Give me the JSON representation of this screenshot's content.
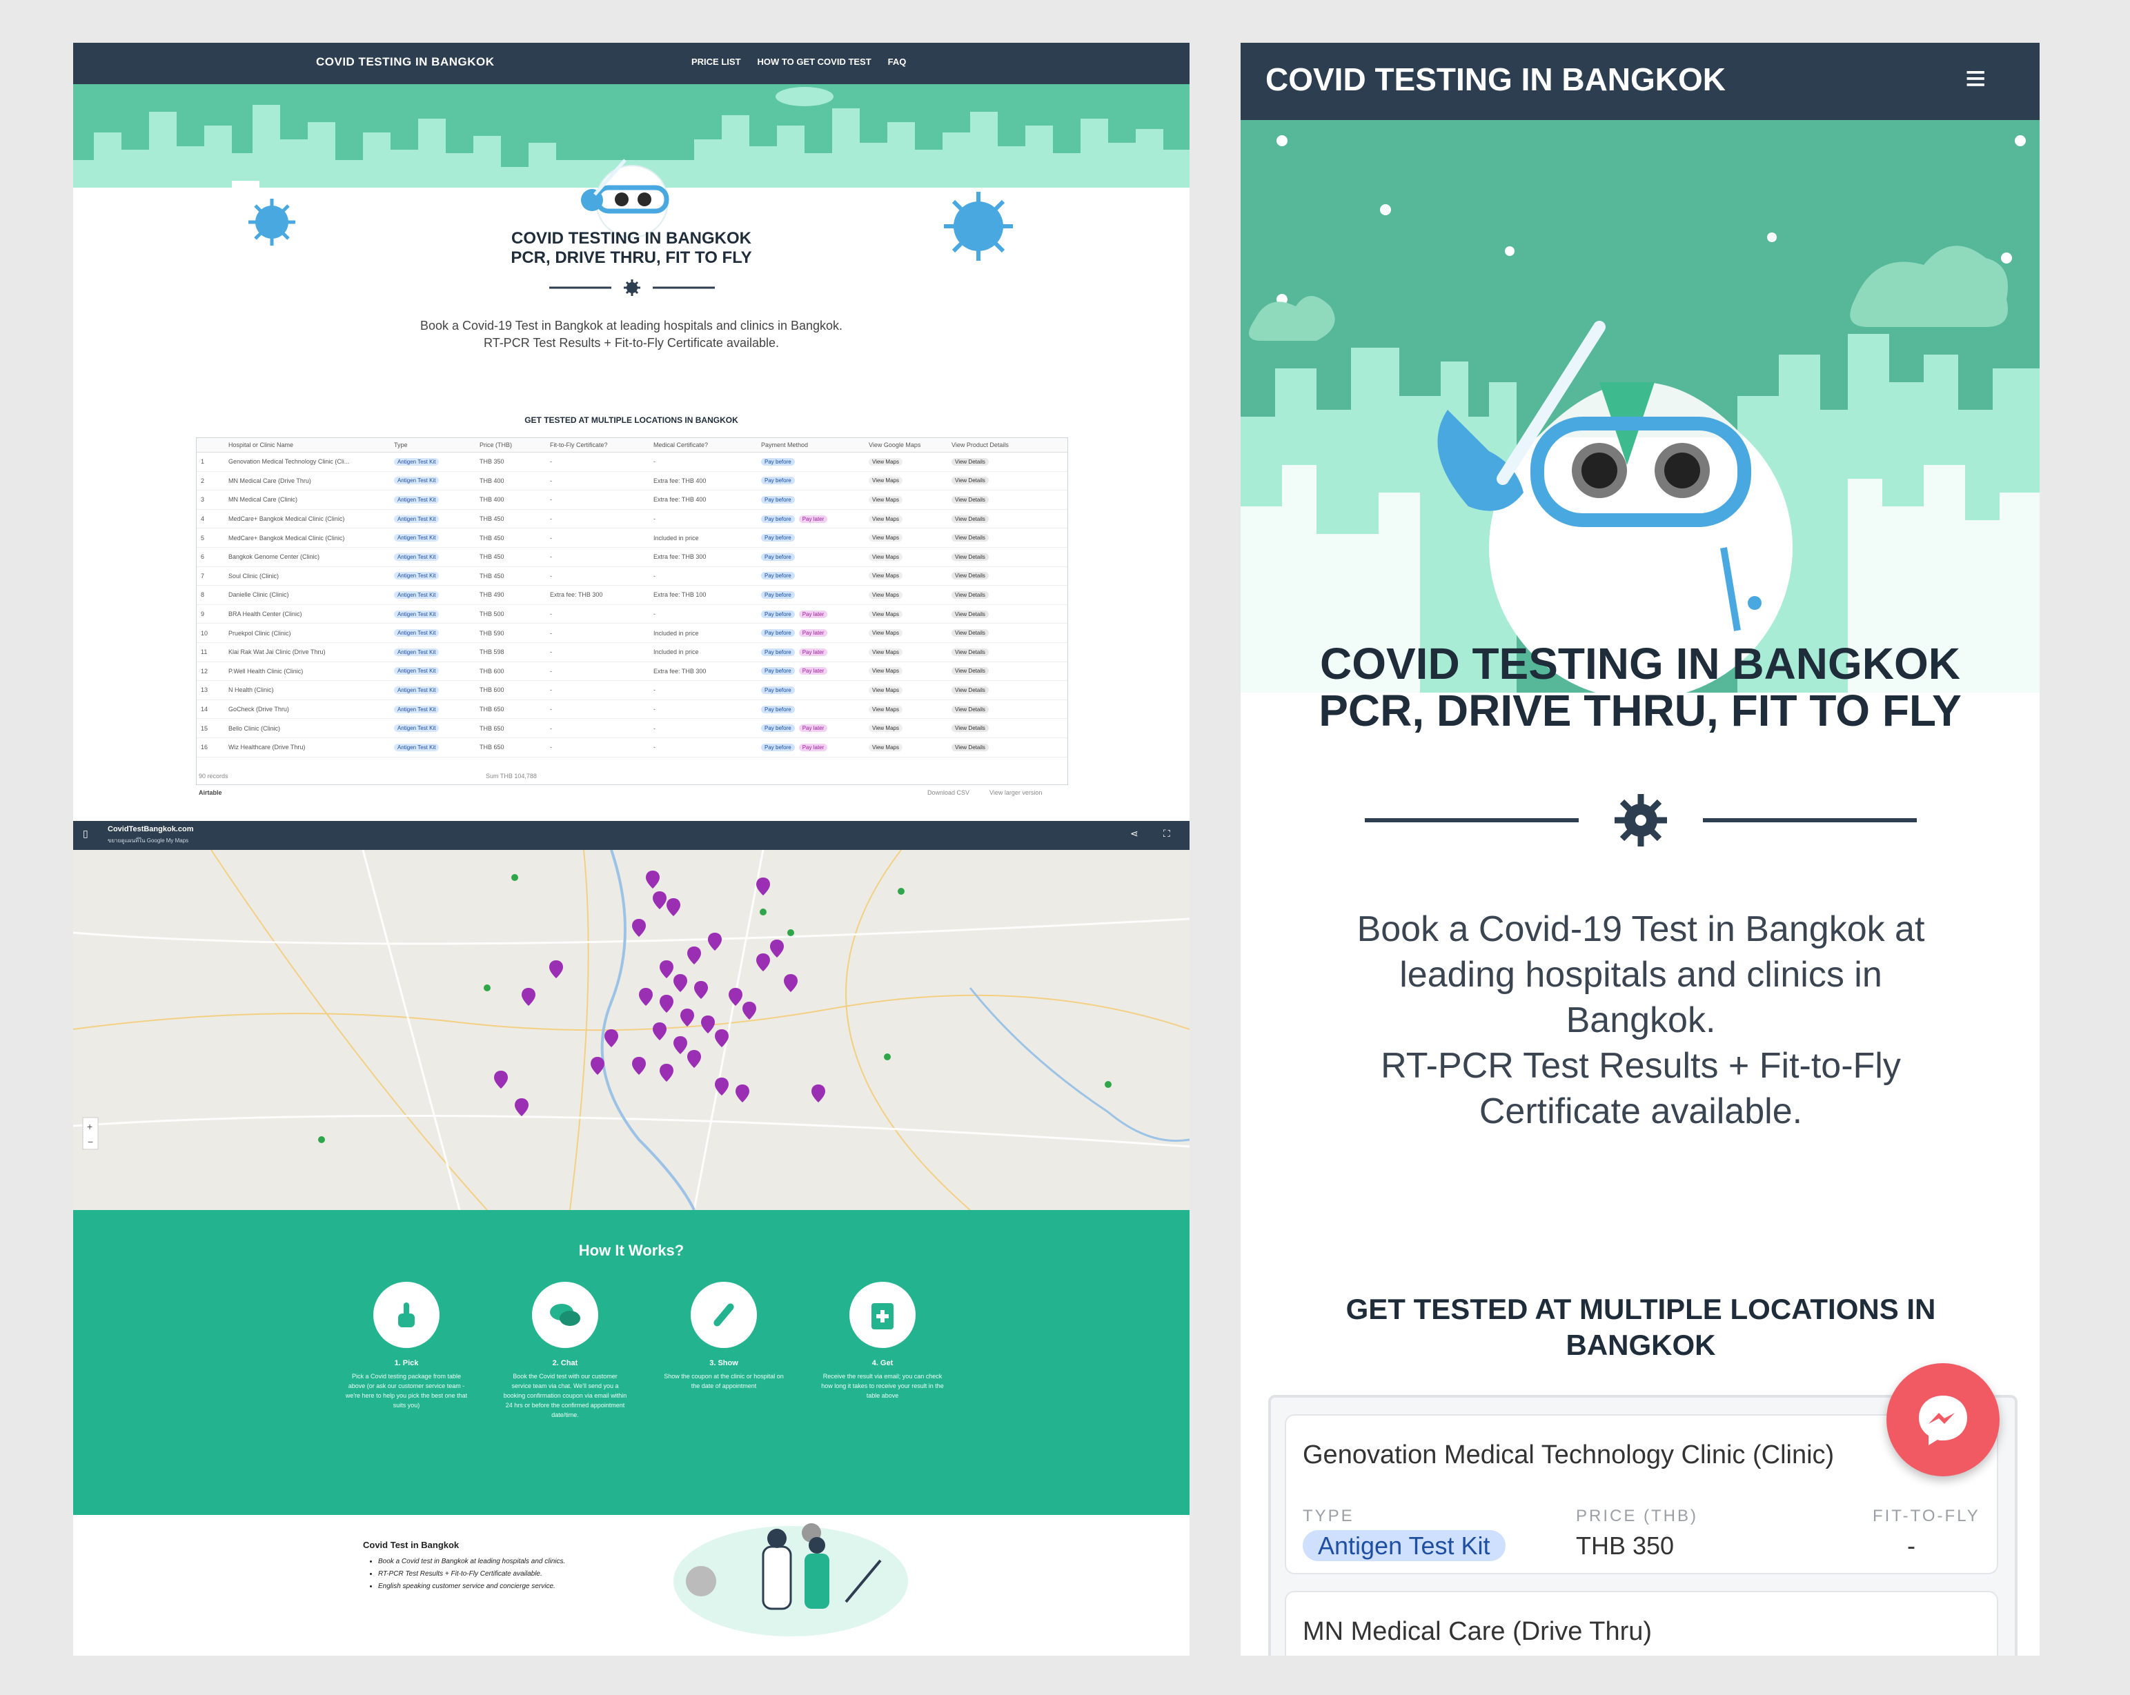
{
  "desktop": {
    "brand": "COVID TESTING IN BANGKOK",
    "nav": [
      "PRICE LIST",
      "HOW TO GET COVID TEST",
      "FAQ"
    ],
    "title_line1": "COVID TESTING IN BANGKOK",
    "title_line2": "PCR, DRIVE THRU, FIT TO FLY",
    "subtitle_line1": "Book a Covid-19 Test in Bangkok at leading hospitals and clinics in Bangkok.",
    "subtitle_line2": "RT-PCR Test Results + Fit-to-Fly Certificate available.",
    "locations_heading": "GET TESTED AT MULTIPLE LOCATIONS IN BANGKOK",
    "table": {
      "headers": [
        "",
        "Hospital or Clinic Name",
        "Type",
        "Price (THB)",
        "Fit-to-Fly Certificate?",
        "Medical Certificate?",
        "Payment Method",
        "View Google Maps",
        "View Product Details"
      ],
      "rows": [
        {
          "n": "1",
          "name": "Genovation Medical Technology Clinic (Cli...",
          "type": "Antigen Test Kit",
          "price": "THB 350",
          "ftf": "-",
          "med": "-",
          "pay": "Pay before",
          "later": ""
        },
        {
          "n": "2",
          "name": "MN Medical Care (Drive Thru)",
          "type": "Antigen Test Kit",
          "price": "THB 400",
          "ftf": "-",
          "med": "Extra fee: THB 400",
          "pay": "Pay before",
          "later": ""
        },
        {
          "n": "3",
          "name": "MN Medical Care (Clinic)",
          "type": "Antigen Test Kit",
          "price": "THB 400",
          "ftf": "-",
          "med": "Extra fee: THB 400",
          "pay": "Pay before",
          "later": ""
        },
        {
          "n": "4",
          "name": "MedCare+ Bangkok Medical Clinic (Clinic)",
          "type": "Antigen Test Kit",
          "price": "THB 450",
          "ftf": "-",
          "med": "-",
          "pay": "Pay before",
          "later": "Pay later"
        },
        {
          "n": "5",
          "name": "MedCare+ Bangkok Medical Clinic (Clinic)",
          "type": "Antigen Test Kit",
          "price": "THB 450",
          "ftf": "-",
          "med": "Included in price",
          "pay": "Pay before",
          "later": ""
        },
        {
          "n": "6",
          "name": "Bangkok Genome Center (Clinic)",
          "type": "Antigen Test Kit",
          "price": "THB 450",
          "ftf": "-",
          "med": "Extra fee: THB 300",
          "pay": "Pay before",
          "later": ""
        },
        {
          "n": "7",
          "name": "Soul Clinic (Clinic)",
          "type": "Antigen Test Kit",
          "price": "THB 450",
          "ftf": "-",
          "med": "-",
          "pay": "Pay before",
          "later": ""
        },
        {
          "n": "8",
          "name": "Danielle Clinic (Clinic)",
          "type": "Antigen Test Kit",
          "price": "THB 490",
          "ftf": "Extra fee: THB 300",
          "med": "Extra fee: THB 100",
          "pay": "Pay before",
          "later": ""
        },
        {
          "n": "9",
          "name": "BRA Health Center (Clinic)",
          "type": "Antigen Test Kit",
          "price": "THB 500",
          "ftf": "-",
          "med": "-",
          "pay": "Pay before",
          "later": "Pay later"
        },
        {
          "n": "10",
          "name": "Pruekpol Clinic (Clinic)",
          "type": "Antigen Test Kit",
          "price": "THB 590",
          "ftf": "-",
          "med": "Included in price",
          "pay": "Pay before",
          "later": "Pay later"
        },
        {
          "n": "11",
          "name": "Klai Rak Wat Jai Clinic (Drive Thru)",
          "type": "Antigen Test Kit",
          "price": "THB 598",
          "ftf": "-",
          "med": "Included in price",
          "pay": "Pay before",
          "later": "Pay later"
        },
        {
          "n": "12",
          "name": "P.Well Health Clinic (Clinic)",
          "type": "Antigen Test Kit",
          "price": "THB 600",
          "ftf": "-",
          "med": "Extra fee: THB 300",
          "pay": "Pay before",
          "later": "Pay later"
        },
        {
          "n": "13",
          "name": "N Health (Clinic)",
          "type": "Antigen Test Kit",
          "price": "THB 600",
          "ftf": "-",
          "med": "-",
          "pay": "Pay before",
          "later": ""
        },
        {
          "n": "14",
          "name": "GoCheck (Drive Thru)",
          "type": "Antigen Test Kit",
          "price": "THB 650",
          "ftf": "-",
          "med": "-",
          "pay": "Pay before",
          "later": ""
        },
        {
          "n": "15",
          "name": "Bello Clinic (Clinic)",
          "type": "Antigen Test Kit",
          "price": "THB 650",
          "ftf": "-",
          "med": "-",
          "pay": "Pay before",
          "later": "Pay later"
        },
        {
          "n": "16",
          "name": "Wiz Healthcare (Drive Thru)",
          "type": "Antigen Test Kit",
          "price": "THB 650",
          "ftf": "-",
          "med": "-",
          "pay": "Pay before",
          "later": "Pay later"
        }
      ],
      "map_label": "View Maps",
      "details_label": "View Details",
      "records": "90 records",
      "sum": "Sum THB 104,788",
      "airtable": "Airtable",
      "download": "Download CSV",
      "view_larger": "View larger version"
    },
    "map": {
      "title": "CovidTestBangkok.com",
      "note": "ขยายดูแผนที่ใน Google My Maps"
    },
    "how": {
      "title": "How It Works?",
      "steps": [
        {
          "title": "1. Pick",
          "desc": "Pick a Covid testing package from table above (or ask our customer service team - we're here to help you pick the best one that suits you)"
        },
        {
          "title": "2. Chat",
          "desc": "Book the Covid test with our customer service team via chat. We'll send you a booking confirmation coupon via email within 24 hrs or before the confirmed appointment date/time."
        },
        {
          "title": "3. Show",
          "desc": "Show the coupon at the clinic or hospital on the date of appointment"
        },
        {
          "title": "4. Get",
          "desc": "Receive the result via email; you can check how long it takes to receive your result in the table above"
        }
      ]
    },
    "footer": {
      "title": "Covid Test in Bangkok",
      "bullets": [
        "Book a Covid test in Bangkok at leading hospitals and clinics.",
        "RT-PCR Test Results + Fit-to-Fly Certificate available.",
        "English speaking customer service and concierge service."
      ]
    }
  },
  "mobile": {
    "brand": "COVID TESTING IN BANGKOK",
    "menu_icon": "hamburger-icon",
    "title_line1": "COVID TESTING IN BANGKOK",
    "title_line2": "PCR, DRIVE THRU, FIT TO FLY",
    "subtitle": [
      "Book a Covid-19 Test in Bangkok at",
      "leading hospitals and clinics in",
      "Bangkok.",
      "RT-PCR Test Results + Fit-to-Fly",
      "Certificate available."
    ],
    "locations_heading": "GET TESTED AT MULTIPLE LOCATIONS IN BANGKOK",
    "card1": {
      "name": "Genovation Medical Technology Clinic (Clinic)",
      "type_label": "TYPE",
      "type": "Antigen Test Kit",
      "price_label": "PRICE (THB)",
      "price": "THB 350",
      "ftf_label": "FIT-TO-FLY",
      "ftf": "-"
    },
    "card2": {
      "name": "MN Medical Care (Drive Thru)"
    },
    "messenger_icon": "messenger-icon"
  },
  "colors": {
    "nav": "#2c3e50",
    "mint": "#a8ecd6",
    "mint_dark": "#5cc6a2",
    "green": "#23b38e",
    "pin": "#9b2fb4",
    "messenger": "#f25a63"
  }
}
